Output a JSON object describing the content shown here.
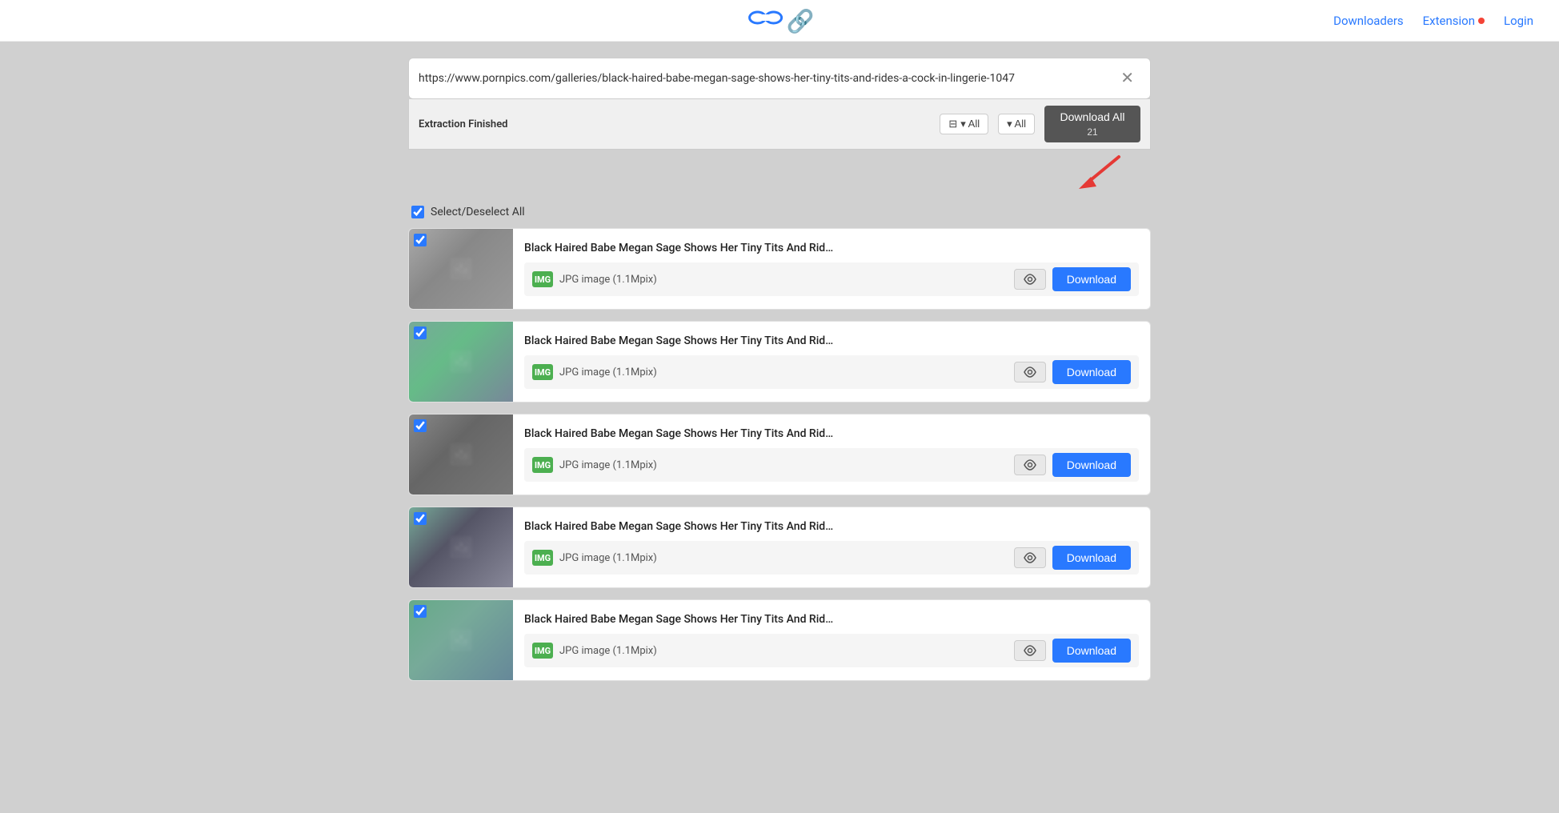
{
  "nav": {
    "downloaders_label": "Downloaders",
    "extension_label": "Extension",
    "login_label": "Login"
  },
  "urlbar": {
    "url": "https://www.pornpics.com/galleries/black-haired-babe-megan-sage-shows-her-tiny-tits-and-rides-a-cock-in-lingerie-1047"
  },
  "toolbar": {
    "status": "Extraction Finished",
    "filter1_label": "▾ All",
    "filter2_label": "▾ All",
    "download_all_label": "Download All",
    "download_all_count": "21"
  },
  "select_all_label": "Select/Deselect All",
  "items": [
    {
      "title": "Black Haired Babe Megan Sage Shows Her Tiny Tits And Rid…",
      "meta": "JPG image (1.1Mpix)",
      "download_label": "Download"
    },
    {
      "title": "Black Haired Babe Megan Sage Shows Her Tiny Tits And Rid…",
      "meta": "JPG image (1.1Mpix)",
      "download_label": "Download"
    },
    {
      "title": "Black Haired Babe Megan Sage Shows Her Tiny Tits And Rid…",
      "meta": "JPG image (1.1Mpix)",
      "download_label": "Download"
    },
    {
      "title": "Black Haired Babe Megan Sage Shows Her Tiny Tits And Rid…",
      "meta": "JPG image (1.1Mpix)",
      "download_label": "Download"
    },
    {
      "title": "Black Haired Babe Megan Sage Shows Her Tiny Tits And Rid…",
      "meta": "JPG image (1.1Mpix)",
      "download_label": "Download"
    }
  ],
  "icons": {
    "filter": "⊟",
    "eye": "👁",
    "image": "IMG",
    "close": "✕"
  },
  "colors": {
    "download_btn": "#2979ff",
    "download_all_btn": "#555555",
    "accent_red": "#f44336"
  }
}
